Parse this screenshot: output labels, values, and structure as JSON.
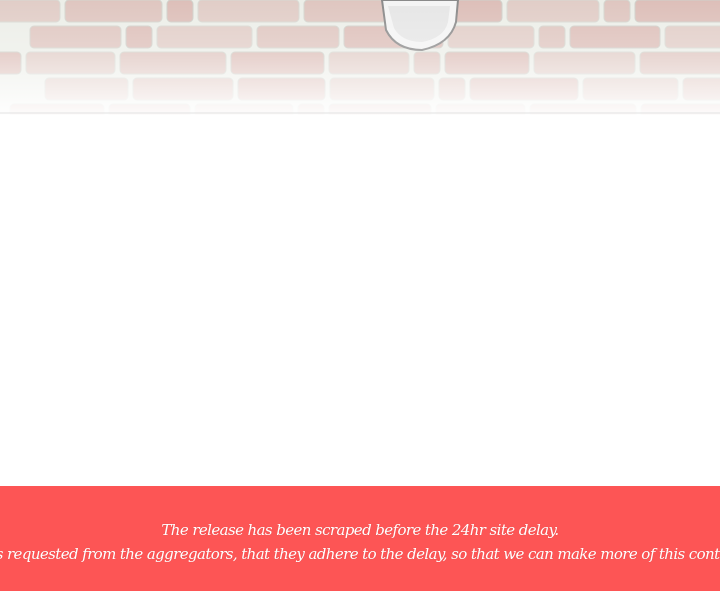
{
  "colors": {
    "banner_background": "#fd5555",
    "banner_text": "#ffffff",
    "page_background": "#ffffff",
    "brick": "#d9b3ad",
    "mortar": "#eceee8"
  },
  "notice": {
    "line1": "The release has been scraped before the 24hr site delay.",
    "line2": "it is requested from the aggregators, that they adhere to the delay, so that we can make more of this content"
  }
}
